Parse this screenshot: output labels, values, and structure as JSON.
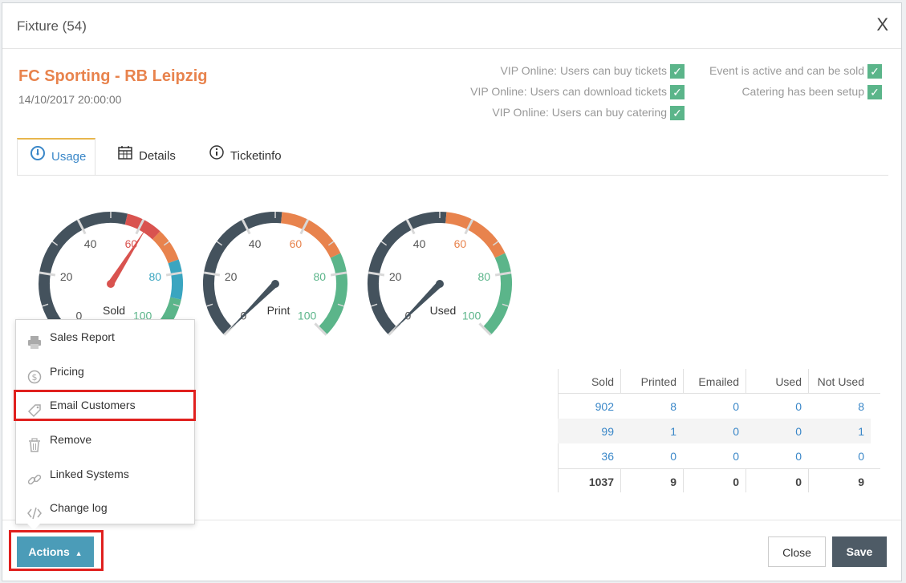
{
  "modal": {
    "title": "Fixture (54)",
    "close": "X"
  },
  "event": {
    "title": "FC Sporting - RB Leipzig",
    "date": "14/10/2017 20:00:00"
  },
  "status_left": [
    "VIP Online: Users can buy tickets",
    "VIP Online: Users can download tickets",
    "VIP Online: Users can buy catering"
  ],
  "status_right": [
    "Event is active and can be sold",
    "Catering has been setup"
  ],
  "check_glyph": "✓",
  "tabs": [
    {
      "label": "Usage",
      "icon": "gauge-icon"
    },
    {
      "label": "Details",
      "icon": "calendar-icon"
    },
    {
      "label": "Ticketinfo",
      "icon": "info-icon"
    }
  ],
  "gauges": [
    {
      "label": "Sold",
      "value": 62,
      "ticks": [
        "0",
        "20",
        "40",
        "60",
        "80",
        "100"
      ]
    },
    {
      "label": "Print",
      "value": 0,
      "ticks": [
        "0",
        "20",
        "40",
        "60",
        "80",
        "100"
      ]
    },
    {
      "label": "Used",
      "value": 0,
      "ticks": [
        "0",
        "20",
        "40",
        "60",
        "80",
        "100"
      ]
    }
  ],
  "table": {
    "headers": [
      "Sold",
      "Printed",
      "Emailed",
      "Used",
      "Not Used"
    ],
    "rows": [
      [
        "902",
        "8",
        "0",
        "0",
        "8"
      ],
      [
        "99",
        "1",
        "0",
        "0",
        "1"
      ],
      [
        "36",
        "0",
        "0",
        "0",
        "0"
      ]
    ],
    "totals": [
      "1037",
      "9",
      "0",
      "0",
      "9"
    ]
  },
  "dropdown": [
    {
      "label": "Sales Report",
      "icon": "printer-icon"
    },
    {
      "label": "Pricing",
      "icon": "dollar-icon"
    },
    {
      "label": "Email Customers",
      "icon": "tag-icon"
    },
    {
      "label": "Remove",
      "icon": "trash-icon"
    },
    {
      "label": "Linked Systems",
      "icon": "link-icon"
    },
    {
      "label": "Change log",
      "icon": "code-icon"
    }
  ],
  "footer": {
    "actions": "Actions",
    "close": "Close",
    "save": "Save"
  },
  "colors": {
    "accent": "#e8834d",
    "link": "#3a87c8",
    "check": "#5bb58a",
    "actions": "#4b9cb8",
    "save": "#4e5b66",
    "highlight": "#e0201e"
  }
}
